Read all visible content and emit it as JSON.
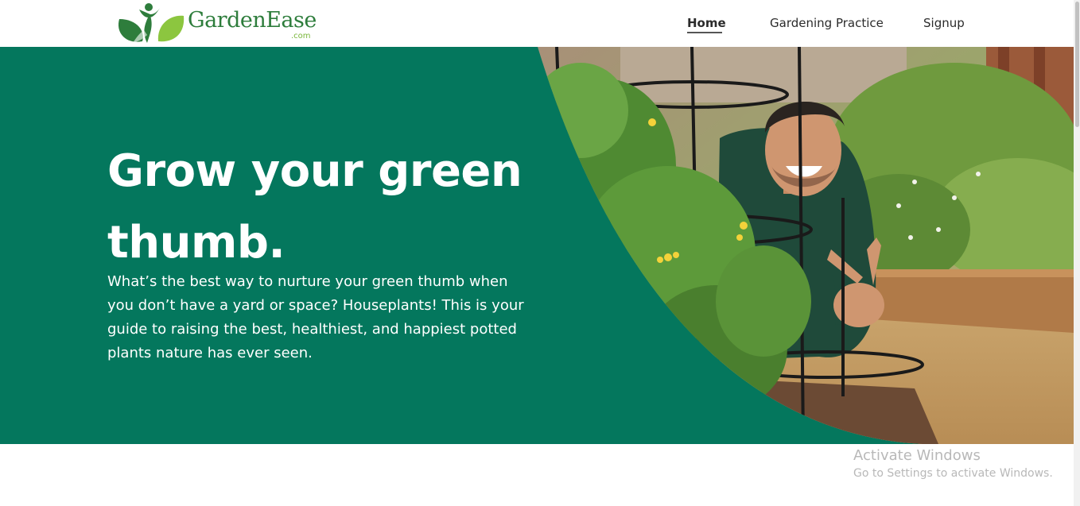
{
  "brand": {
    "name": "GardenEase",
    "suffix": ".com",
    "dark_green": "#2e7d3c",
    "light_green": "#79b63a"
  },
  "nav": {
    "items": [
      {
        "label": "Home",
        "active": true
      },
      {
        "label": "Gardening Practice",
        "active": false
      },
      {
        "label": "Signup",
        "active": false
      }
    ]
  },
  "hero": {
    "title": "Grow your green thumb.",
    "description": "What’s the best way to nurture your green thumb when you don’t have a yard or space? Houseplants! This is your guide to raising the best, healthiest, and happiest potted plants nature has ever seen.",
    "background_color": "#04775d",
    "photo_subject": "smiling man pointing at himself in a vegetable garden"
  },
  "system_overlay": {
    "title": "Activate Windows",
    "subtitle": "Go to Settings to activate Windows."
  }
}
